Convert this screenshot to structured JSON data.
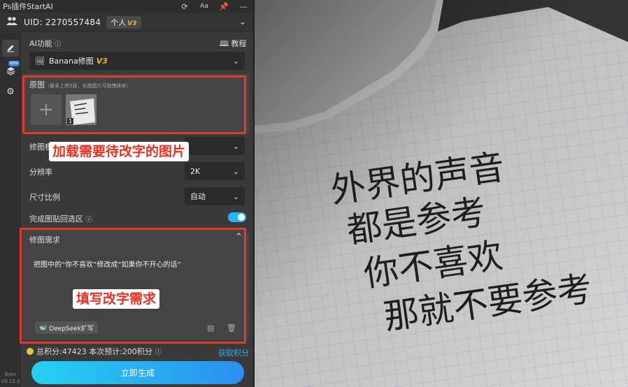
{
  "titlebar": {
    "title": "Ps插件StartAI",
    "icons": [
      "refresh-icon",
      "font-size-icon",
      "pin-icon",
      "minimize-icon"
    ]
  },
  "user": {
    "uid_label": "UID: 2270557484",
    "plan": "个人",
    "plan_version": "V3"
  },
  "sidebar": {
    "items": [
      "edit-icon",
      "layers-icon",
      "gear-icon"
    ],
    "new_tag": "NEW",
    "beta_label": "Beta",
    "version": "V0.22.3"
  },
  "ai_function": {
    "label": "AI功能",
    "tutorial_label": "教程",
    "selected": "Banana修图",
    "selected_version": "V3"
  },
  "source": {
    "label": "原图",
    "hint": "（最多上传5张，长按图片可拖拽排序）",
    "image_count": "1"
  },
  "mode_row": {
    "label": "修图模式"
  },
  "resolution": {
    "label": "分辨率",
    "value": "2K"
  },
  "aspect": {
    "label": "尺寸比例",
    "value": "自动"
  },
  "paste_back": {
    "label": "完成图贴回选区",
    "enabled": true
  },
  "requirement": {
    "label": "修图需求",
    "text": "把图中的“你不喜欢”修改成“如果你不开心的话”",
    "deepseek_label": "DeepSeek扩写"
  },
  "footer": {
    "points_text": "总积分:47423  本次预计:200积分",
    "get_points": "获取积分",
    "generate": "立即生成"
  },
  "callouts": {
    "upload": "加载需要待改字的图片",
    "requirement": "填写改字需求"
  },
  "note_lines": [
    "外界的声音",
    "都是参考",
    "你不喜欢",
    "那就不要参考"
  ],
  "colors": {
    "accent": "#23b7f2",
    "callout_red": "#e23a2e",
    "version_gold": "#e8b341"
  }
}
